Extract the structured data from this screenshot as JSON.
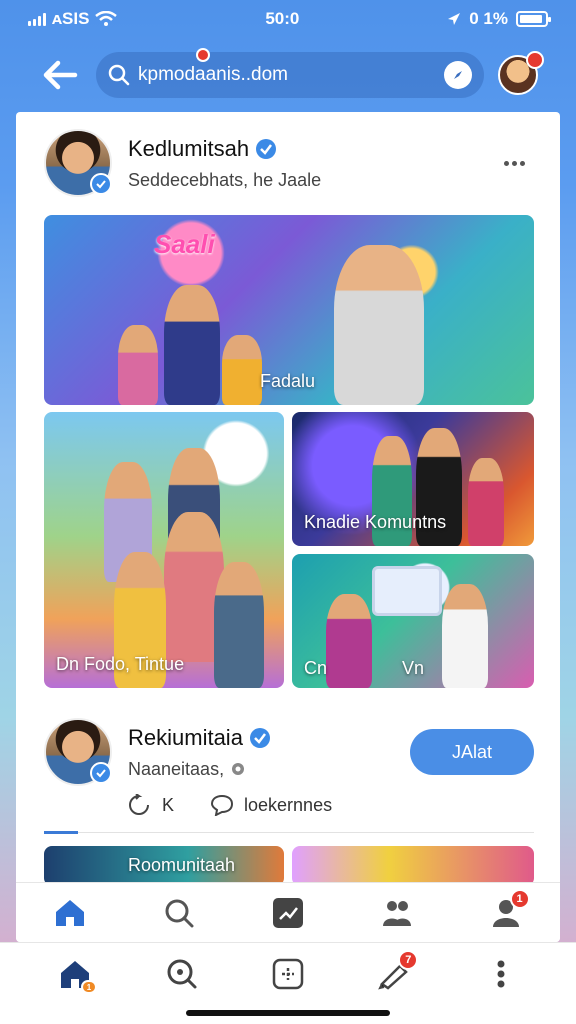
{
  "status_bar": {
    "carrier": "ᴀSIS",
    "time": "50:0",
    "battery": "0 1%",
    "battery_level": 0.92
  },
  "top_bar": {
    "search_value": "kpmodaanis..dom",
    "search_icon": "search-icon",
    "back_icon": "arrow-left-icon",
    "compass_icon": "compass-icon",
    "avatar_badge": ""
  },
  "post": {
    "author": "Kedlumitsah",
    "subtitle": "Seddecebhats, he Jaale",
    "verified": true,
    "tiles": [
      {
        "caption": "Fadalu",
        "overlay": "Saali"
      },
      {
        "caption": "Dn  Fodo, Tintue"
      },
      {
        "caption": "Knadie Komuntns"
      },
      {
        "caption": "Cn               Vn"
      }
    ]
  },
  "post2": {
    "author": "Rekiumitaia",
    "subtitle": "Naaneitaas,",
    "join_label": "JAlat",
    "action_1": "K",
    "action_2": "loekernnes",
    "preview_1": "Roomunitaah",
    "preview_2": ""
  },
  "inner_nav": {
    "items": [
      "home-icon",
      "search-icon",
      "chart-icon",
      "groups-icon",
      "profile-icon"
    ],
    "profile_badge": "1"
  },
  "bottom_nav": {
    "items": [
      "home-icon",
      "explore-icon",
      "add-icon",
      "notifications-icon",
      "more-icon"
    ],
    "notif_badge": "7",
    "home_badge": "1"
  },
  "colors": {
    "accent": "#4a8ee6",
    "badge": "#e5392f",
    "nav_active": "#2e6fd2"
  }
}
